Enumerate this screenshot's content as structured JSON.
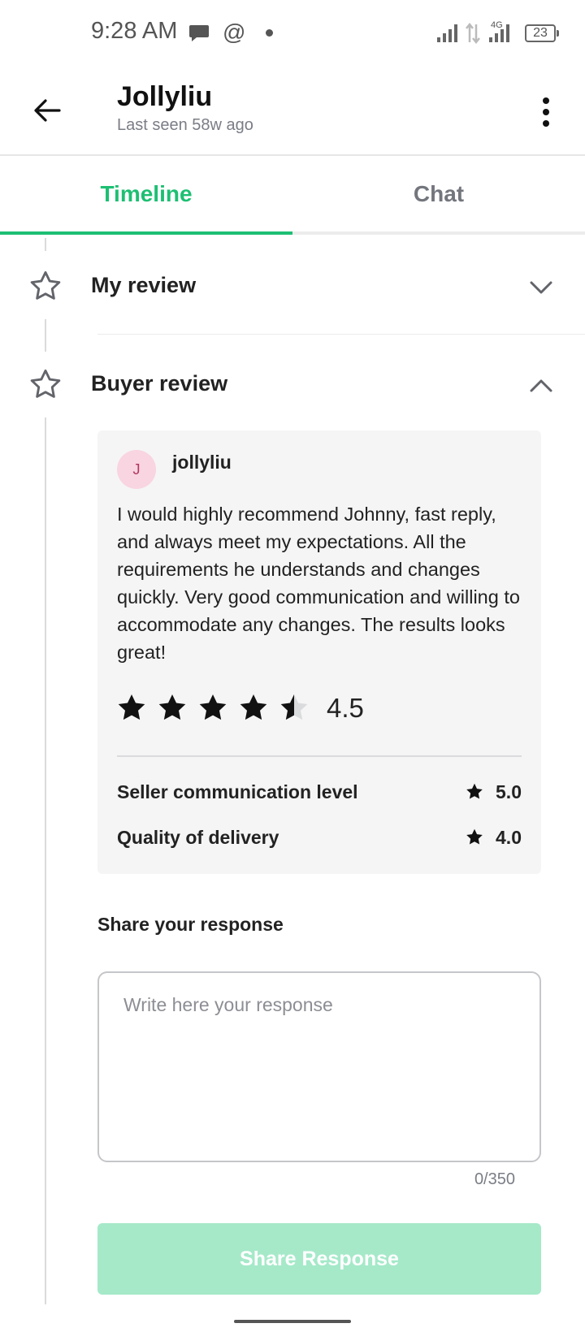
{
  "status_bar": {
    "time": "9:28 AM",
    "network_label": "4G",
    "battery": "23",
    "icons": [
      "message-icon",
      "threads-icon",
      "dot-icon",
      "signal-icon",
      "data-arrows-icon",
      "signal-4g-icon",
      "battery-icon"
    ]
  },
  "header": {
    "title": "Jollyliu",
    "subtitle": "Last seen 58w ago",
    "back_icon": "arrow-left-icon",
    "more_icon": "more-vertical-icon"
  },
  "tabs": [
    {
      "label": "Timeline",
      "active": true
    },
    {
      "label": "Chat",
      "active": false
    }
  ],
  "timeline": {
    "my_review": {
      "title": "My review",
      "expanded": false,
      "icon": "star-outline-icon"
    },
    "buyer_review": {
      "title": "Buyer review",
      "expanded": true,
      "icon": "star-outline-icon"
    }
  },
  "review": {
    "avatar_initial": "J",
    "reviewer": "jollyliu",
    "text": "I would highly recommend Johnny, fast reply, and always meet my expectations. All the requirements he understands and changes quickly. Very good communication and willing to accommodate any changes. The results looks great!",
    "rating": 4.5,
    "rating_label": "4.5",
    "sub_ratings": [
      {
        "label": "Seller communication level",
        "value": "5.0"
      },
      {
        "label": "Quality of delivery",
        "value": "4.0"
      }
    ]
  },
  "response": {
    "label": "Share your response",
    "placeholder": "Write here your response",
    "value": "",
    "counter": "0/350",
    "button_label": "Share Response"
  },
  "colors": {
    "accent": "#1dbf73",
    "button_disabled": "#a5e9c9",
    "card_bg": "#f5f5f5",
    "avatar_bg": "#f9d4e1"
  }
}
